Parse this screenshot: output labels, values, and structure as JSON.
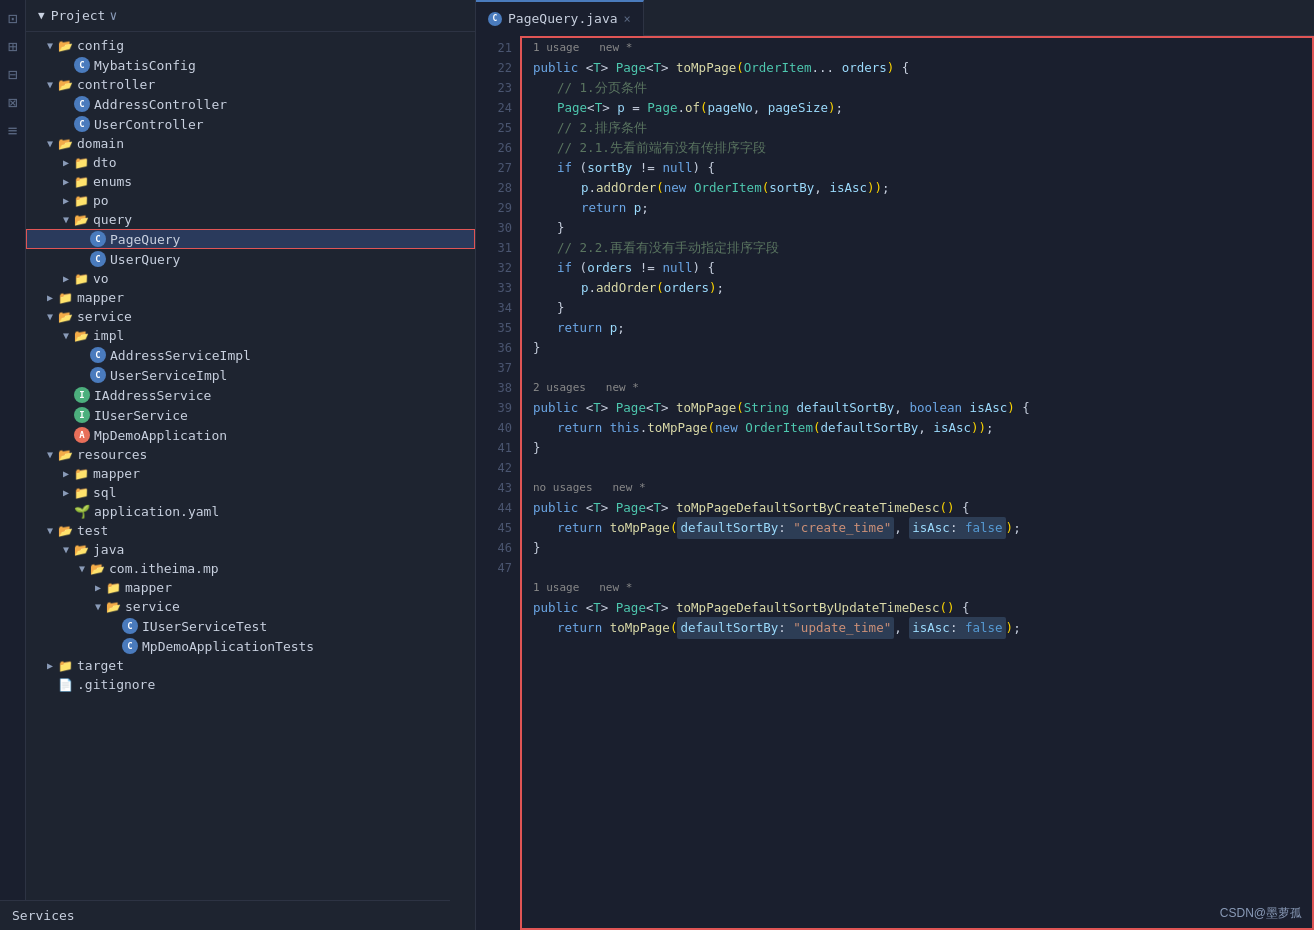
{
  "header": {
    "title": "Project",
    "tab": {
      "icon": "C",
      "label": "PageQuery.java",
      "close": "×"
    }
  },
  "sidebar": {
    "tree": [
      {
        "id": "config",
        "level": 1,
        "type": "folder",
        "label": "config",
        "expanded": true
      },
      {
        "id": "mybatis-config",
        "level": 2,
        "type": "class-c",
        "label": "MybatisConfig"
      },
      {
        "id": "controller",
        "level": 1,
        "type": "folder",
        "label": "controller",
        "expanded": true
      },
      {
        "id": "address-controller",
        "level": 2,
        "type": "class-c",
        "label": "AddressController"
      },
      {
        "id": "user-controller",
        "level": 2,
        "type": "class-c",
        "label": "UserController"
      },
      {
        "id": "domain",
        "level": 1,
        "type": "folder",
        "label": "domain",
        "expanded": true
      },
      {
        "id": "dto",
        "level": 2,
        "type": "folder",
        "label": "dto",
        "collapsed": true
      },
      {
        "id": "enums",
        "level": 2,
        "type": "folder",
        "label": "enums",
        "collapsed": true
      },
      {
        "id": "po",
        "level": 2,
        "type": "folder",
        "label": "po",
        "collapsed": true
      },
      {
        "id": "query",
        "level": 2,
        "type": "folder",
        "label": "query",
        "expanded": true
      },
      {
        "id": "page-query",
        "level": 3,
        "type": "class-c",
        "label": "PageQuery",
        "selected": true
      },
      {
        "id": "user-query",
        "level": 3,
        "type": "class-c",
        "label": "UserQuery"
      },
      {
        "id": "vo",
        "level": 2,
        "type": "folder",
        "label": "vo",
        "collapsed": true
      },
      {
        "id": "mapper",
        "level": 1,
        "type": "folder",
        "label": "mapper",
        "collapsed": true
      },
      {
        "id": "service",
        "level": 1,
        "type": "folder",
        "label": "service",
        "expanded": true
      },
      {
        "id": "impl",
        "level": 2,
        "type": "folder",
        "label": "impl",
        "expanded": true
      },
      {
        "id": "address-service-impl",
        "level": 3,
        "type": "class-c",
        "label": "AddressServiceImpl"
      },
      {
        "id": "user-service-impl",
        "level": 3,
        "type": "class-c",
        "label": "UserServiceImpl"
      },
      {
        "id": "iaddress-service",
        "level": 2,
        "type": "class-i",
        "label": "IAddressService"
      },
      {
        "id": "iuser-service",
        "level": 2,
        "type": "class-i",
        "label": "IUserService"
      },
      {
        "id": "mp-demo-app",
        "level": 2,
        "type": "class-a",
        "label": "MpDemoApplication"
      },
      {
        "id": "resources",
        "level": 1,
        "type": "folder",
        "label": "resources",
        "expanded": true
      },
      {
        "id": "mapper-res",
        "level": 2,
        "type": "folder",
        "label": "mapper",
        "collapsed": true
      },
      {
        "id": "sql",
        "level": 2,
        "type": "folder",
        "label": "sql",
        "collapsed": true
      },
      {
        "id": "app-yaml",
        "level": 2,
        "type": "yaml",
        "label": "application.yaml"
      },
      {
        "id": "test",
        "level": 1,
        "type": "folder",
        "label": "test",
        "expanded": true
      },
      {
        "id": "java-test",
        "level": 2,
        "type": "folder",
        "label": "java",
        "expanded": true
      },
      {
        "id": "com-itheima-mp",
        "level": 3,
        "type": "folder",
        "label": "com.itheima.mp",
        "expanded": true
      },
      {
        "id": "mapper-test",
        "level": 4,
        "type": "folder",
        "label": "mapper",
        "collapsed": true
      },
      {
        "id": "service-test",
        "level": 4,
        "type": "folder",
        "label": "service",
        "expanded": true
      },
      {
        "id": "iuser-service-test",
        "level": 5,
        "type": "class-c",
        "label": "IUserServiceTest"
      },
      {
        "id": "mp-demo-app-tests",
        "level": 5,
        "type": "class-c",
        "label": "MpDemoApplicationTests"
      },
      {
        "id": "target",
        "level": 1,
        "type": "folder",
        "label": "target",
        "collapsed": true
      },
      {
        "id": "gitignore",
        "level": 1,
        "type": "file",
        "label": ".gitignore"
      }
    ],
    "services_label": "Services"
  },
  "editor": {
    "lines": [
      {
        "num": 21,
        "type": "meta",
        "content": "1 usage   new *"
      },
      {
        "num": 22,
        "type": "code",
        "content": "PUBLIC_T_PAGE_TOMPAGE_ORDERITEM"
      },
      {
        "num": 23,
        "type": "code",
        "content": "COMMENT_PAGECONDITION"
      },
      {
        "num": 24,
        "type": "code",
        "content": "PAGE_OF"
      },
      {
        "num": 25,
        "type": "code",
        "content": "COMMENT_SORT"
      },
      {
        "num": 26,
        "type": "code",
        "content": "COMMENT_SORT_21"
      },
      {
        "num": 27,
        "type": "code",
        "content": "IF_SORTBY"
      },
      {
        "num": 28,
        "type": "code",
        "content": "P_ADDORDER_ORDERITEM"
      },
      {
        "num": 29,
        "type": "code",
        "content": "RETURN_P"
      },
      {
        "num": 30,
        "type": "code",
        "content": "CLOSE_BRACE"
      },
      {
        "num": 31,
        "type": "code",
        "content": "COMMENT_22"
      },
      {
        "num": 32,
        "type": "code",
        "content": "IF_ORDERS"
      },
      {
        "num": 33,
        "type": "code",
        "content": "P_ADDORDER_ORDERS"
      },
      {
        "num": 34,
        "type": "code",
        "content": "CLOSE_BRACE"
      },
      {
        "num": 35,
        "type": "code",
        "content": "RETURN_P2"
      },
      {
        "num": 36,
        "type": "code",
        "content": "CLOSE_BRACE_MAIN"
      },
      {
        "num": 37,
        "type": "empty"
      },
      {
        "num": 38,
        "type": "meta_code",
        "content": "2 usages   new *"
      },
      {
        "num": 38,
        "type": "code",
        "content": "PUBLIC_T_PAGE_TOMPAGE_STRING"
      },
      {
        "num": 39,
        "type": "code",
        "content": "RETURN_THIS_TOMPAGE"
      },
      {
        "num": 40,
        "type": "code",
        "content": "CLOSE_BRACE2"
      },
      {
        "num": 41,
        "type": "empty"
      },
      {
        "num": 42,
        "type": "meta_code2",
        "content": "no usages   new *"
      },
      {
        "num": 42,
        "type": "code",
        "content": "PUBLIC_T_PAGE_DEFAULTSORTBYCREATE"
      },
      {
        "num": 43,
        "type": "code",
        "content": "RETURN_TOMPAGE_CREATE"
      },
      {
        "num": 44,
        "type": "code",
        "content": "CLOSE_BRACE3"
      },
      {
        "num": 45,
        "type": "empty"
      },
      {
        "num": 46,
        "type": "meta_code3",
        "content": "1 usage   new *"
      },
      {
        "num": 46,
        "type": "code",
        "content": "PUBLIC_T_PAGE_DEFAULTSORTBYUPDATE"
      },
      {
        "num": 47,
        "type": "code",
        "content": "RETURN_TOMPAGE_UPDATE"
      }
    ]
  },
  "watermark": "CSDN@墨萝孤",
  "icons": {
    "chevron_right": "▶",
    "chevron_down": "▼",
    "folder": "📁"
  }
}
